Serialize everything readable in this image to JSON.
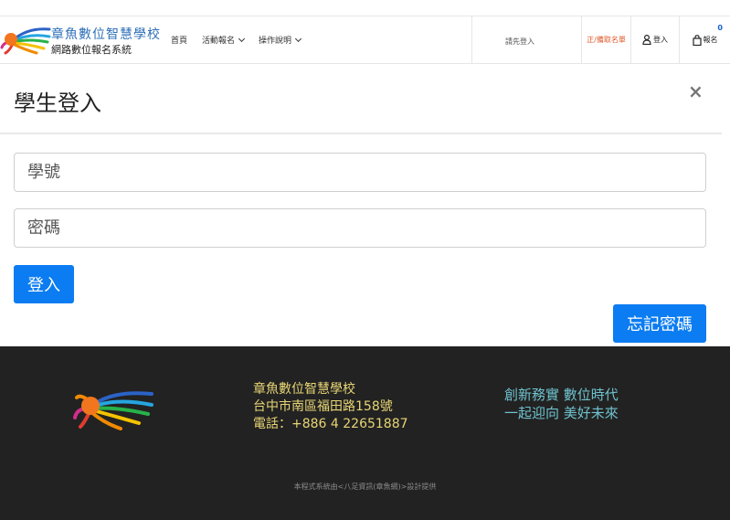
{
  "header": {
    "brand_name": "章魚數位智慧學校",
    "brand_subtitle": "網路數位報名系統",
    "nav": [
      {
        "label": "首頁"
      },
      {
        "label": "活動報名"
      },
      {
        "label": "操作說明"
      }
    ],
    "prompt_text": "請先登入",
    "list_link": "正/備取名單",
    "login_label": "登入",
    "signup_label": "報名",
    "cart_count": "0",
    "icons": {
      "login": "user-icon",
      "signup": "shopping-bag-icon",
      "dropdown": "chevron-down-icon"
    },
    "colors": {
      "brand": "#2e6fb7",
      "list_link": "#e05a2b",
      "badge": "#1a5fd0"
    }
  },
  "modal": {
    "title": "學生登入",
    "close_symbol": "×",
    "student_id_placeholder": "學號",
    "password_placeholder": "密碼",
    "login_button": "登入",
    "forgot_button": "忘記密碼",
    "colors": {
      "button": "#0b7cf2"
    }
  },
  "footer": {
    "school_name": "章魚數位智慧學校",
    "address": "台中市南區福田路158號",
    "phone": "電話：+886 4 22651887",
    "slogan_line1": "創新務實  數位時代",
    "slogan_line2": "一起迎向  美好未來",
    "credit": "本程式系統由<八足資訊(章魚網)>設計提供",
    "colors": {
      "background": "#222222",
      "address": "#e8d575",
      "slogan": "#6fc3cf"
    }
  }
}
